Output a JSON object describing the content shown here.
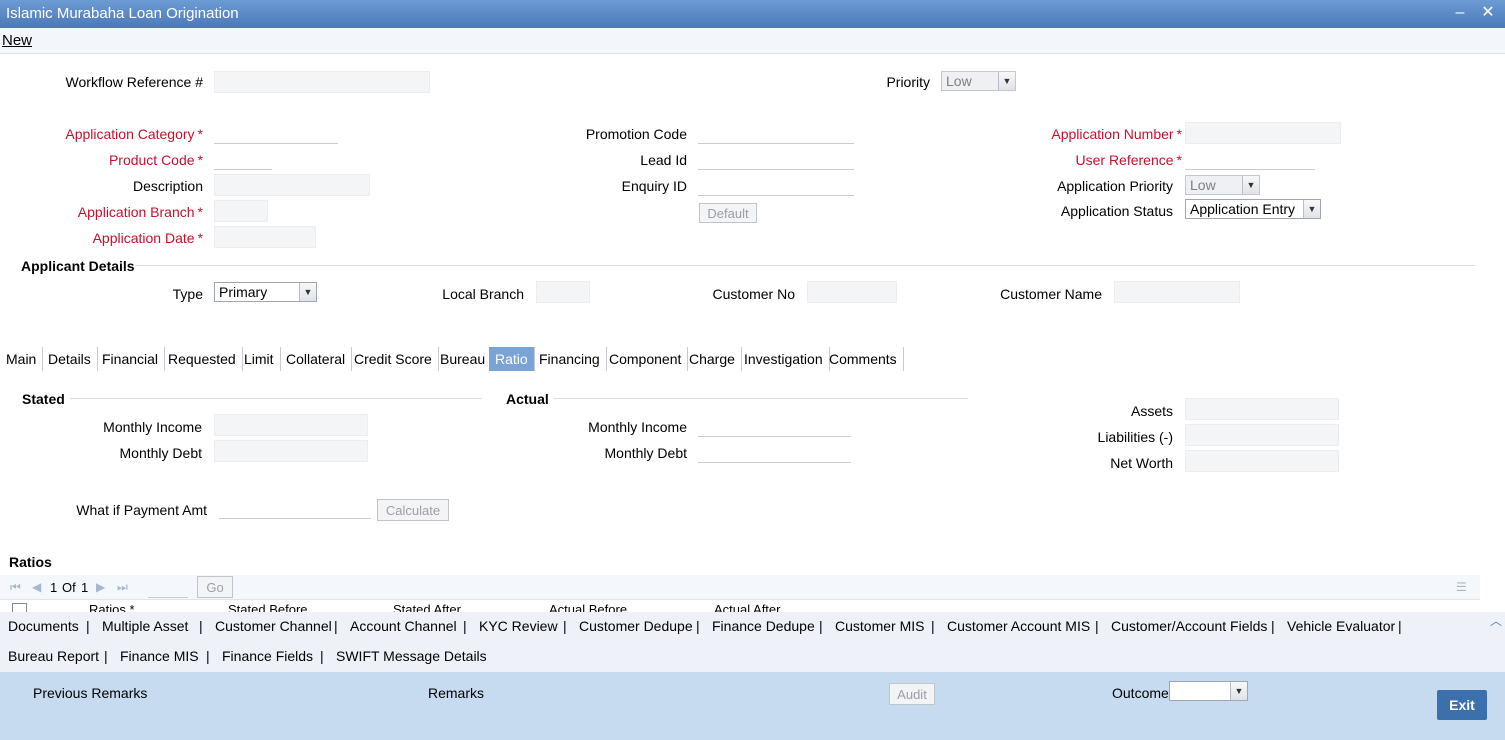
{
  "window": {
    "title": "Islamic Murabaha Loan Origination",
    "minimize": "–",
    "close": "✕"
  },
  "menu": {
    "new": "New"
  },
  "header": {
    "workflow_ref_label": "Workflow Reference #",
    "priority_label": "Priority",
    "priority_value": "Low"
  },
  "form": {
    "app_category_label": "Application Category",
    "product_code_label": "Product Code",
    "description_label": "Description",
    "app_branch_label": "Application Branch",
    "app_date_label": "Application Date",
    "promotion_code_label": "Promotion Code",
    "lead_id_label": "Lead Id",
    "enquiry_id_label": "Enquiry ID",
    "default_button": "Default",
    "app_number_label": "Application Number",
    "user_ref_label": "User Reference",
    "app_priority_label": "Application Priority",
    "app_priority_value": "Low",
    "app_status_label": "Application Status",
    "app_status_value": "Application Entry",
    "required_mark": "*"
  },
  "applicant": {
    "section_title": "Applicant Details",
    "type_label": "Type",
    "type_value": "Primary",
    "local_branch_label": "Local Branch",
    "customer_no_label": "Customer No",
    "customer_name_label": "Customer Name"
  },
  "tabs": [
    "Main",
    "Details",
    "Financial",
    "Requested",
    "Limit",
    "Collateral",
    "Credit Score",
    "Bureau",
    "Ratio",
    "Financing",
    "Component",
    "Charge",
    "Investigation",
    "Comments"
  ],
  "active_tab": "Ratio",
  "ratio": {
    "stated_title": "Stated",
    "actual_title": "Actual",
    "monthly_income_label": "Monthly Income",
    "monthly_debt_label": "Monthly Debt",
    "assets_label": "Assets",
    "liabilities_label": "Liabilities (-)",
    "net_worth_label": "Net Worth",
    "what_if_label": "What if Payment Amt",
    "calculate_button": "Calculate"
  },
  "ratios_grid": {
    "title": "Ratios",
    "page_current": "1",
    "page_of": "Of",
    "page_total": "1",
    "go_button": "Go",
    "columns": [
      "Ratios *",
      "Stated Before",
      "Stated After",
      "Actual Before",
      "Actual After"
    ]
  },
  "bottom_links": {
    "row1": [
      "Documents",
      "Multiple Asset",
      "Customer Channel",
      "Account Channel",
      "KYC Review",
      "Customer Dedupe",
      "Finance Dedupe",
      "Customer MIS",
      "Customer Account MIS",
      "Customer/Account Fields",
      "Vehicle Evaluator"
    ],
    "row2": [
      "Bureau Report",
      "Finance MIS",
      "Finance Fields",
      "SWIFT Message Details"
    ],
    "separator": "|"
  },
  "footer": {
    "previous_remarks": "Previous Remarks",
    "remarks": "Remarks",
    "audit_button": "Audit",
    "outcome_label": "Outcome",
    "exit_button": "Exit"
  }
}
